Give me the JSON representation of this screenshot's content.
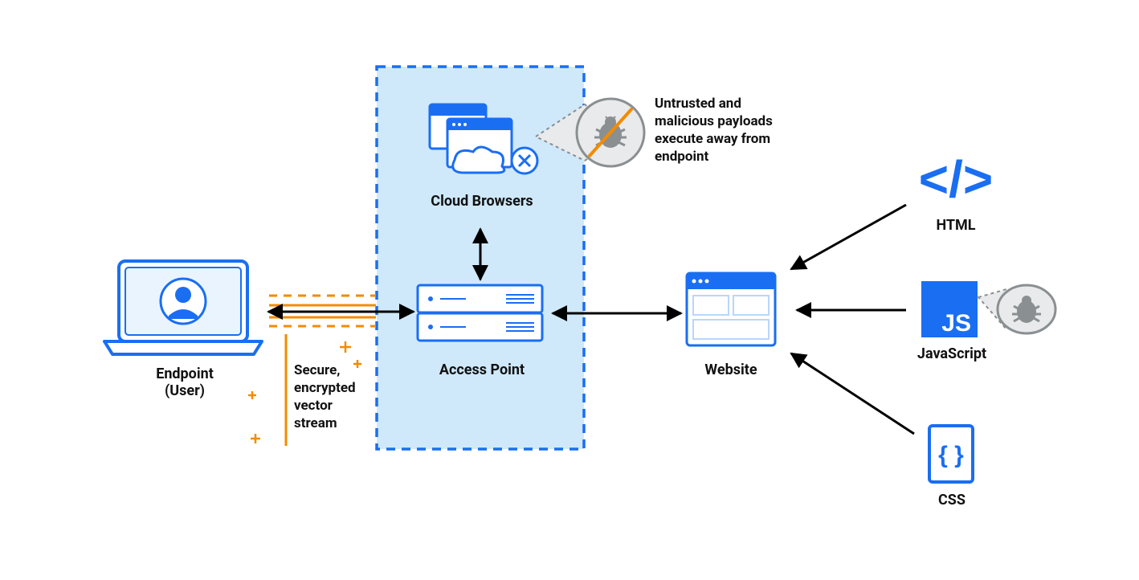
{
  "labels": {
    "endpoint_line1": "Endpoint",
    "endpoint_line2": "(User)",
    "stream_line1": "Secure,",
    "stream_line2": "encrypted",
    "stream_line3": "vector",
    "stream_line4": "stream",
    "cloud_browsers": "Cloud Browsers",
    "access_point": "Access Point",
    "website": "Website",
    "html": "HTML",
    "javascript": "JavaScript",
    "css": "CSS",
    "js_logo": "JS"
  },
  "annotations": {
    "payload_line1": "Untrusted and",
    "payload_line2": "malicious payloads",
    "payload_line3": "execute away from",
    "payload_line4": "endpoint"
  },
  "colors": {
    "blue": "#1a6ef2",
    "light_blue_fill": "#cfe9fb",
    "orange": "#f38b00",
    "black": "#000000",
    "grey": "#8a8f92"
  }
}
